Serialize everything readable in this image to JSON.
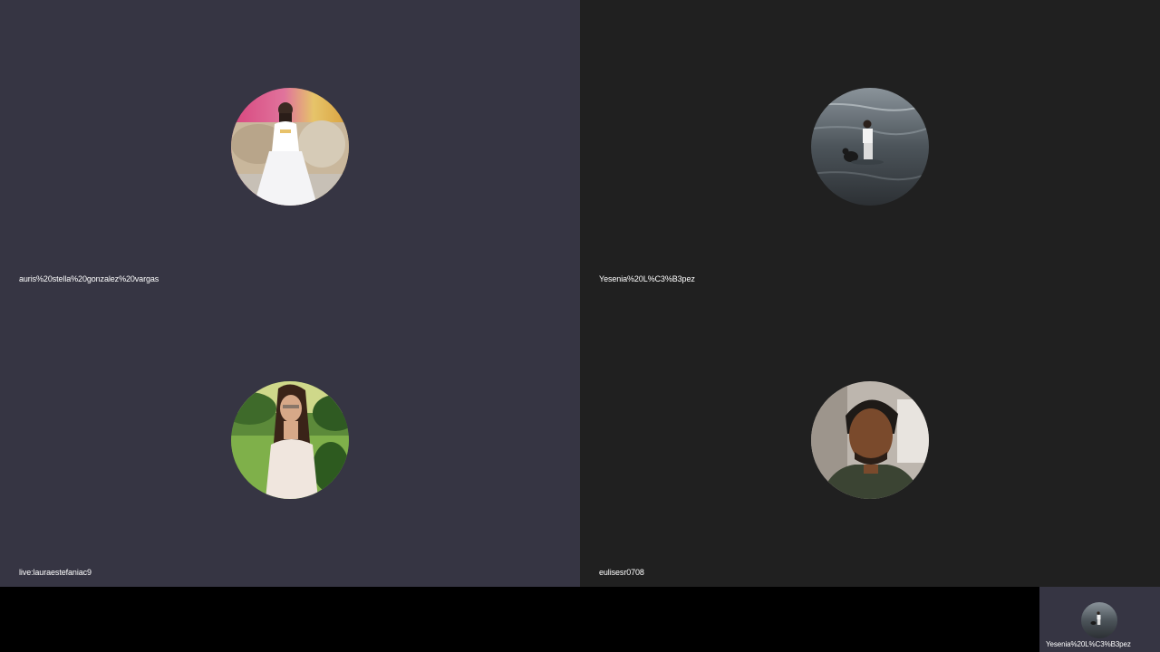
{
  "participants": [
    {
      "name": "auris%20stella%20gonzalez%20vargas",
      "avatar": "photo-woman-white-dress-sofa",
      "tile_color": "#363543"
    },
    {
      "name": "Yesenia%20L%C3%B3pez",
      "avatar": "photo-woman-in-water-with-dog",
      "tile_color": "#202020"
    },
    {
      "name": "live:lauraestefaniac9",
      "avatar": "photo-woman-garden-glasses",
      "tile_color": "#363543"
    },
    {
      "name": "eulisesr0708",
      "avatar": "photo-man-selfie",
      "tile_color": "#202020"
    }
  ],
  "self_view": {
    "name": "Yesenia%20L%C3%B3pez",
    "avatar": "photo-woman-in-water-with-dog"
  }
}
